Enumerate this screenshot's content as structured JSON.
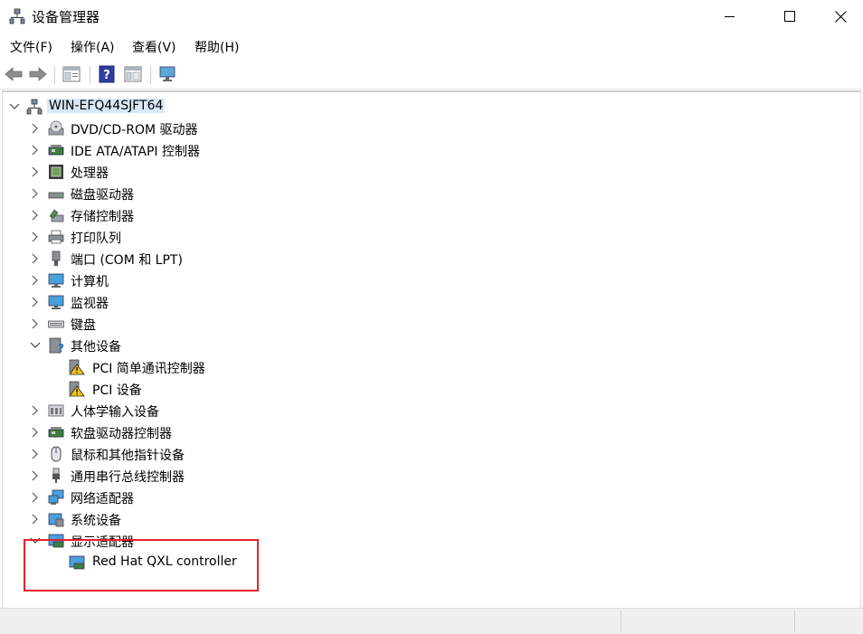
{
  "window": {
    "title": "设备管理器",
    "icon": "device-manager-icon"
  },
  "menu": {
    "items": [
      {
        "label": "文件(F)"
      },
      {
        "label": "操作(A)"
      },
      {
        "label": "查看(V)"
      },
      {
        "label": "帮助(H)"
      }
    ]
  },
  "toolbar": {
    "buttons": [
      "back-icon",
      "forward-icon",
      "properties-icon",
      "help-icon",
      "view-icon",
      "monitor-icon"
    ]
  },
  "tree": {
    "root": "WIN-EFQ44SJFT64",
    "items": [
      {
        "label": "DVD/CD-ROM 驱动器",
        "icon": "dvd-drive-icon",
        "state": "collapsed"
      },
      {
        "label": "IDE ATA/ATAPI 控制器",
        "icon": "ide-controller-icon",
        "state": "collapsed"
      },
      {
        "label": "处理器",
        "icon": "processor-icon",
        "state": "collapsed"
      },
      {
        "label": "磁盘驱动器",
        "icon": "disk-drive-icon",
        "state": "collapsed"
      },
      {
        "label": "存储控制器",
        "icon": "storage-controller-icon",
        "state": "collapsed"
      },
      {
        "label": "打印队列",
        "icon": "printer-icon",
        "state": "collapsed"
      },
      {
        "label": "端口 (COM 和 LPT)",
        "icon": "port-icon",
        "state": "collapsed"
      },
      {
        "label": "计算机",
        "icon": "computer-icon",
        "state": "collapsed"
      },
      {
        "label": "监视器",
        "icon": "monitor-icon",
        "state": "collapsed"
      },
      {
        "label": "键盘",
        "icon": "keyboard-icon",
        "state": "collapsed"
      },
      {
        "label": "其他设备",
        "icon": "other-devices-icon",
        "state": "expanded",
        "children": [
          {
            "label": "PCI 简单通讯控制器",
            "icon": "warning-device-icon"
          },
          {
            "label": "PCI 设备",
            "icon": "warning-device-icon"
          }
        ]
      },
      {
        "label": "人体学输入设备",
        "icon": "hid-icon",
        "state": "collapsed"
      },
      {
        "label": "软盘驱动器控制器",
        "icon": "floppy-controller-icon",
        "state": "collapsed"
      },
      {
        "label": "鼠标和其他指针设备",
        "icon": "mouse-icon",
        "state": "collapsed"
      },
      {
        "label": "通用串行总线控制器",
        "icon": "usb-icon",
        "state": "collapsed"
      },
      {
        "label": "网络适配器",
        "icon": "network-adapter-icon",
        "state": "collapsed"
      },
      {
        "label": "系统设备",
        "icon": "system-device-icon",
        "state": "collapsed"
      },
      {
        "label": "显示适配器",
        "icon": "display-adapter-icon",
        "state": "expanded",
        "children": [
          {
            "label": "Red Hat QXL controller",
            "icon": "display-adapter-icon"
          }
        ]
      }
    ]
  },
  "colors": {
    "highlight_border": "#e8212b",
    "selection_bg": "#d9e8f7"
  }
}
